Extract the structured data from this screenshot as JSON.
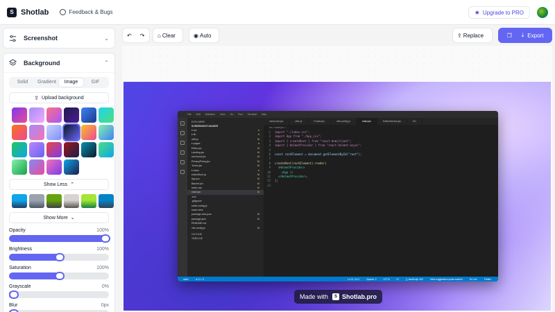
{
  "app": {
    "name": "Shotlab",
    "feedback": "Feedback & Bugs",
    "upgrade": "Upgrade to PRO"
  },
  "sidebar": {
    "screenshot_title": "Screenshot",
    "background_title": "Background",
    "tabs": [
      "Solid",
      "Gradient",
      "Image",
      "GIF"
    ],
    "active_tab": "Image",
    "upload_label": "Upload background",
    "show_less": "Show Less",
    "show_more": "Show More",
    "gradients": [
      "#7c3aed,#ec4899",
      "#a78bfa,#f0abfc",
      "#fb7185,#a855f7",
      "#1e1b4b,#4c1d95",
      "#3b82f6,#1e3a8a",
      "#22d3ee,#4ade80",
      "#f97316,#ec4899",
      "#a78bfa,#f472b6",
      "#c7d2fe,#818cf8",
      "#0f172a,#6366f1",
      "#fbbf24,#ec4899",
      "#86efac,#3b82f6",
      "#22c55e,#0ea5e9",
      "#c084fc,#6366f1",
      "#ef4444,#7c3aed",
      "#991b1b,#1e1b4b",
      "#0891b2,#0f172a",
      "#4ade80,#0ea5e9",
      "#86efac,#16a34a",
      "#818cf8,#ec4899",
      "#f472b6,#7c3aed",
      "#0ea5e9,#1e1b4b"
    ],
    "photos": [
      "#0ea5e9,#1e3a5f",
      "#9ca3af,#4b5563",
      "#65a30d,#3f3f46",
      "#d6d3d1,#57534e",
      "#a3e635,#15803d",
      "#0284c7,#334155"
    ],
    "sliders": [
      {
        "label": "Opacity",
        "value": "100%",
        "fraction": 1.0
      },
      {
        "label": "Brightness",
        "value": "100%",
        "fraction": 0.5
      },
      {
        "label": "Saturation",
        "value": "100%",
        "fraction": 0.5
      },
      {
        "label": "Grayscale",
        "value": "0%",
        "fraction": 0.0
      },
      {
        "label": "Blur",
        "value": "0px",
        "fraction": 0.0
      }
    ]
  },
  "toolbar": {
    "clear": "Clear",
    "auto": "Auto",
    "replace": "Replace",
    "export": "Export"
  },
  "editor": {
    "menu": [
      "File",
      "Edit",
      "Selection",
      "View",
      "Go",
      "Run",
      "Terminal",
      "Help"
    ],
    "explorer_header": "EXPLORER",
    "project": "SCREENSHOT-MAKER",
    "tree": [
      {
        "n": "▾ src",
        "m": "●"
      },
      {
        "n": "  ▾ lib",
        "m": "●"
      },
      {
        "n": "     utils.js",
        "m": "M"
      },
      {
        "n": "  ▾ pages",
        "m": "●"
      },
      {
        "n": "     Editor.jsx",
        "m": "M"
      },
      {
        "n": "     Landing.jsx",
        "m": "M"
      },
      {
        "n": "     not-found.jsx",
        "m": "M"
      },
      {
        "n": "     PrivacyPolicy.jsx",
        "m": "M"
      },
      {
        "n": "     Terms.jsx",
        "m": "M"
      },
      {
        "n": "  ▾ store",
        "m": "●"
      },
      {
        "n": "     editorStore.js",
        "m": "M"
      },
      {
        "n": "   App.jsx",
        "m": "M"
      },
      {
        "n": "   Banner.jsx",
        "m": "M"
      },
      {
        "n": "   index.css",
        "m": "M"
      },
      {
        "n": "   main.jsx",
        "m": "M"
      },
      {
        "n": " .env",
        "m": ""
      },
      {
        "n": " .gitignore",
        "m": ""
      },
      {
        "n": " eslint.config.js",
        "m": ""
      },
      {
        "n": " index.html",
        "m": ""
      },
      {
        "n": " package-lock.json",
        "m": "M"
      },
      {
        "n": " package.json",
        "m": "M"
      },
      {
        "n": " README.md",
        "m": ""
      },
      {
        "n": " vite.config.js",
        "m": "M"
      }
    ],
    "outline": "OUTLINE",
    "timeline": "TIMELINE",
    "tabs": [
      "viewCard.jsx",
      "utils.js",
      "Footer.jsx",
      "vite.config.js",
      "main.jsx",
      "EditorNavbar.jsx",
      "Ed"
    ],
    "active_tab": "main.jsx",
    "breadcrumb": "src  >  main.jsx  >  ...",
    "code": [
      "import \"./index.css\";",
      "import App from \"./App.jsx\";",
      "import { createRoot } from \"react-dom/client\";",
      "import { HelmetProvider } from \"react-helmet-async\";",
      "",
      "const rootElement = document.getElementById(\"root\");",
      "",
      "createRoot(rootElement).render(",
      "  <HelmetProvider>",
      "    <App />",
      "  </HelmetProvider>,",
      ");",
      ""
    ],
    "status_left": [
      "main*",
      "⊗ 0 ⚠ 0"
    ],
    "status_right": [
      "Ln 13, Col 1",
      "Spaces: 2",
      "UTF-8",
      "LF",
      "{} JavaScript JSX",
      "Inline suggestions quota reached",
      "Go Live",
      "Prettier"
    ]
  },
  "watermark": {
    "prefix": "Made with",
    "brand": "Shotlab.pro"
  },
  "colors": {
    "accent": "#6366f1"
  }
}
